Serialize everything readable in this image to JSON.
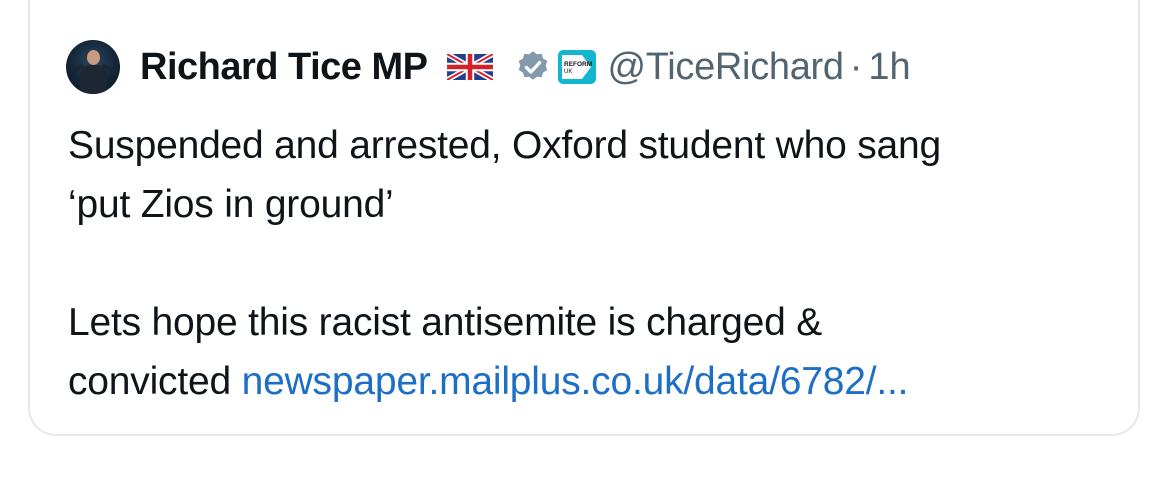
{
  "tweet": {
    "author_name": "Richard Tice MP",
    "handle": "@TiceRichard",
    "separator": "·",
    "time": "1h",
    "flag_icon": "uk-flag-icon",
    "verified_icon": "verified-badge-icon",
    "affiliation_badge_text": "REFORM UK",
    "text_lines": [
      "Suspended and arrested, Oxford student who sang",
      "‘put Zios in ground’",
      "Lets hope this racist antisemite is charged &",
      "convicted "
    ],
    "link_text": "newspaper.mailplus.co.uk/data/6782/...",
    "colors": {
      "text": "#0f1419",
      "secondary": "#536471",
      "link": "#1d6fc4",
      "border": "#e6e9ec",
      "verified": "#829aab",
      "reform": "#12b6cf"
    }
  }
}
